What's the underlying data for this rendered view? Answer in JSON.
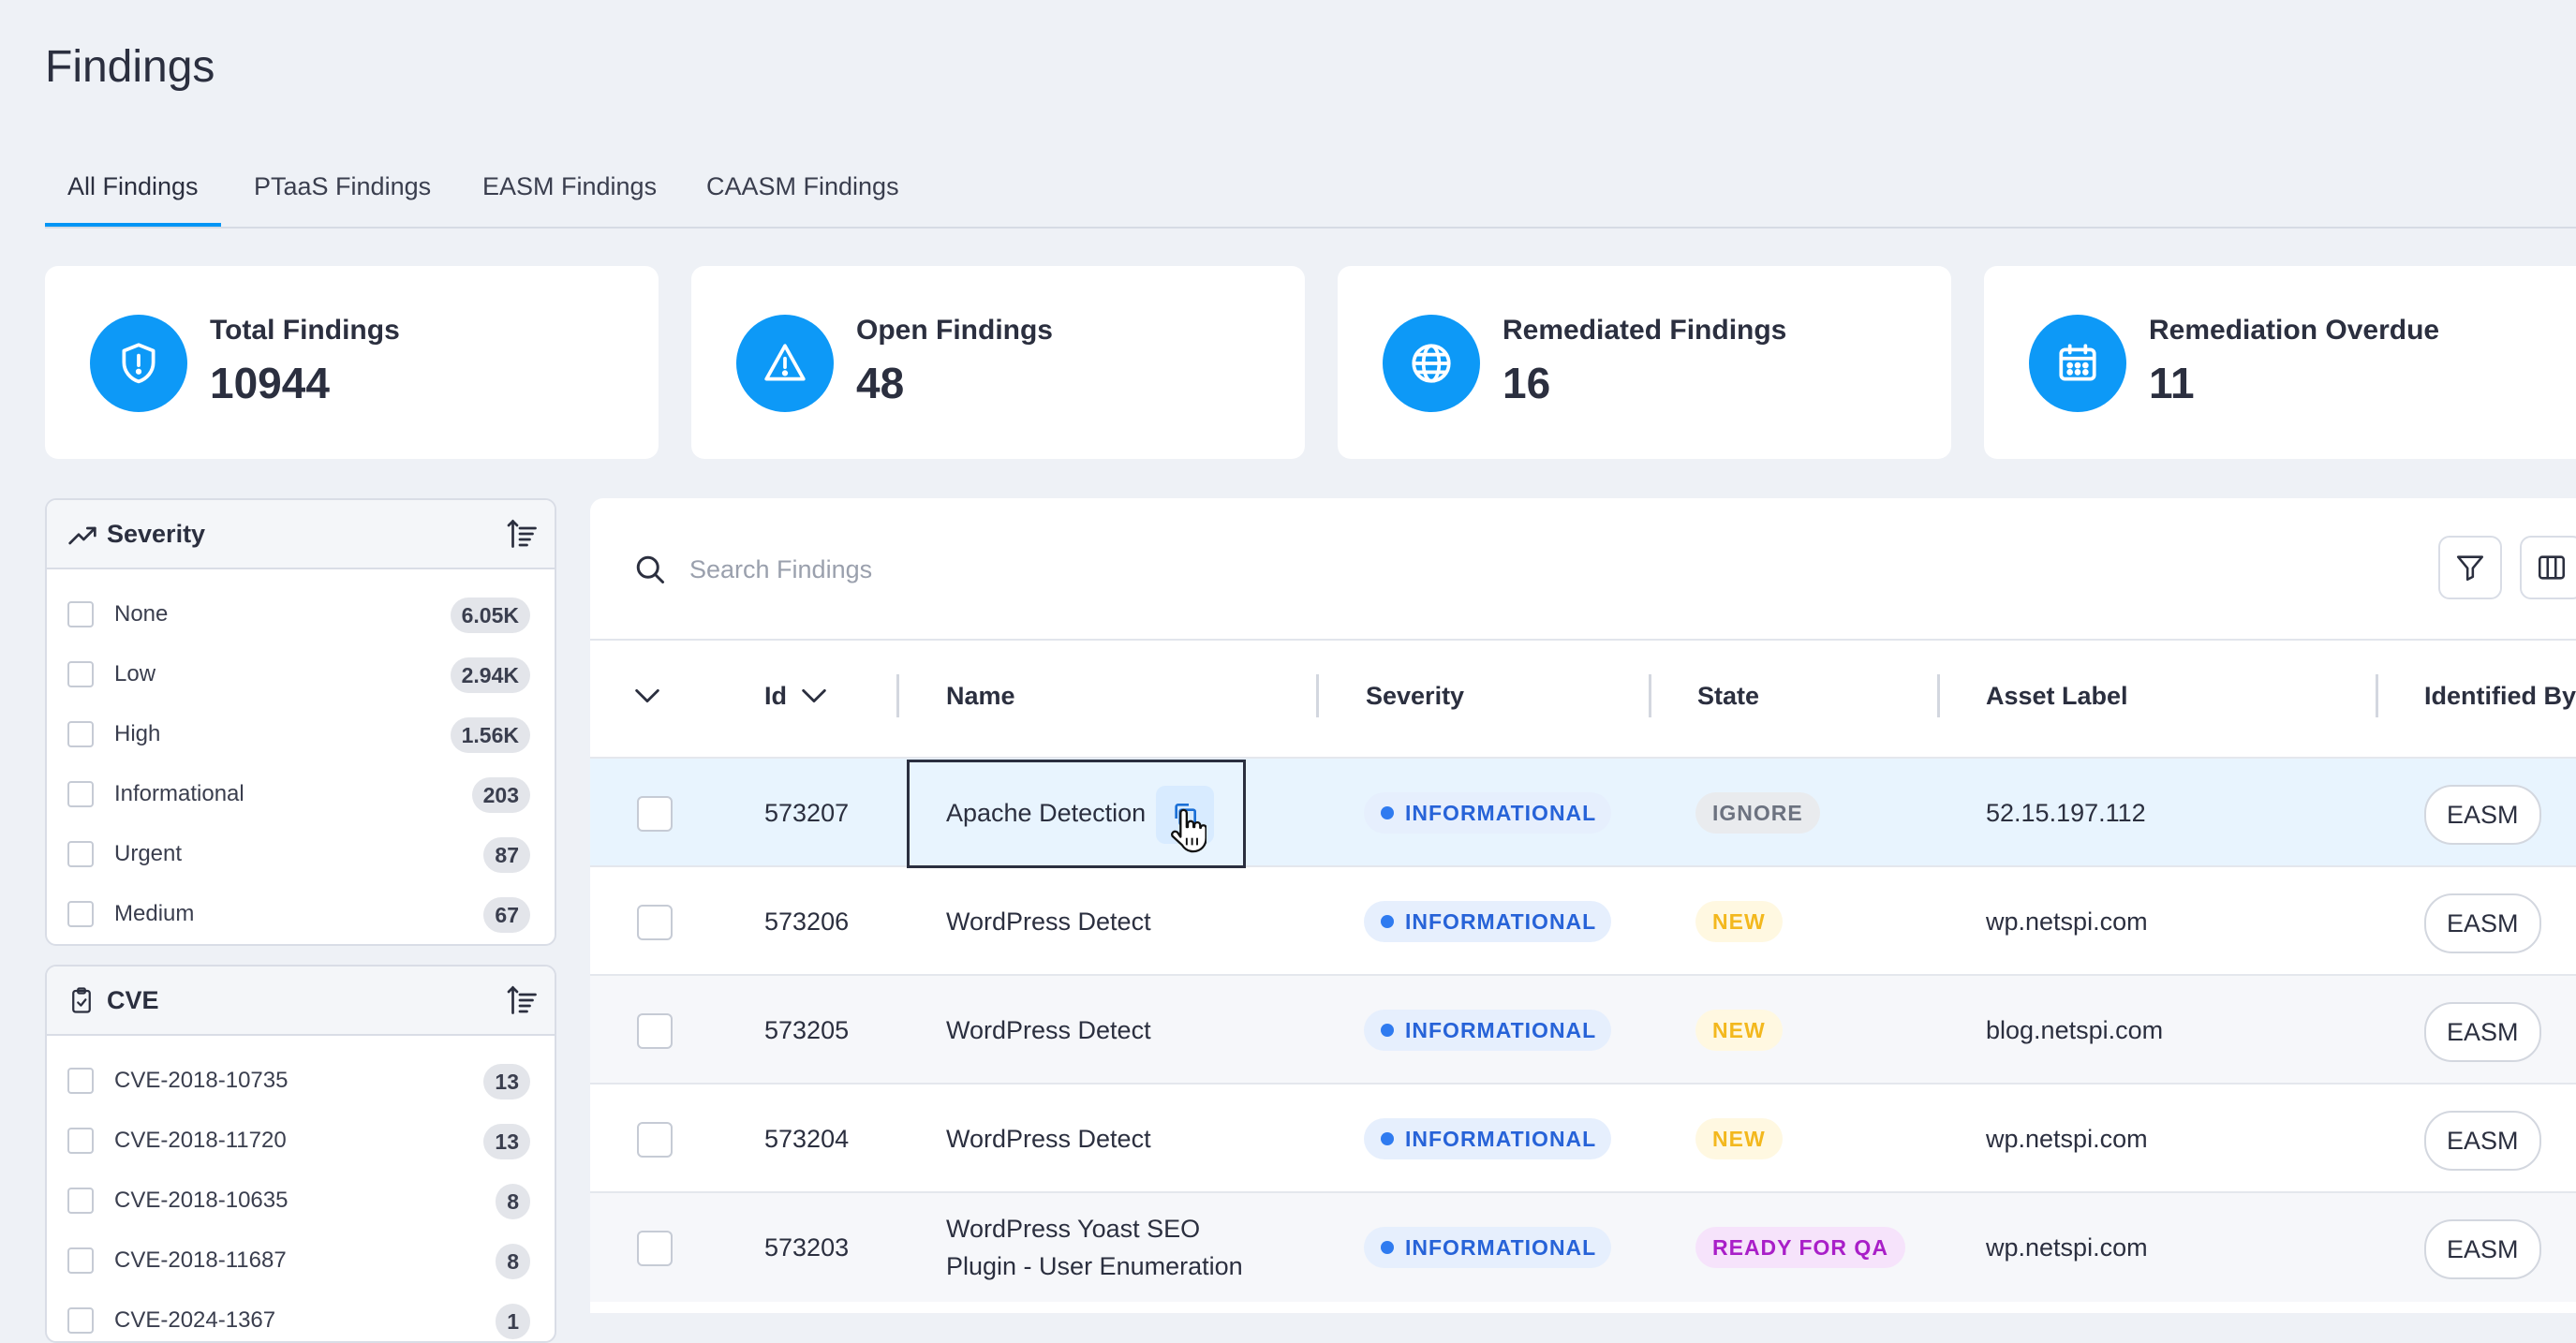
{
  "page": {
    "title": "Findings"
  },
  "tabs": [
    {
      "label": "All Findings",
      "active": true
    },
    {
      "label": "PTaaS Findings"
    },
    {
      "label": "EASM Findings"
    },
    {
      "label": "CAASM Findings"
    }
  ],
  "stats": [
    {
      "label": "Total Findings",
      "value": "10944",
      "icon": "shield-alert-icon"
    },
    {
      "label": "Open Findings",
      "value": "48",
      "icon": "warning-triangle-icon"
    },
    {
      "label": "Remediated Findings",
      "value": "16",
      "icon": "globe-icon"
    },
    {
      "label": "Remediation Overdue",
      "value": "11",
      "icon": "calendar-icon"
    }
  ],
  "facets": {
    "severity": {
      "title": "Severity",
      "items": [
        {
          "label": "None",
          "count": "6.05K"
        },
        {
          "label": "Low",
          "count": "2.94K"
        },
        {
          "label": "High",
          "count": "1.56K"
        },
        {
          "label": "Informational",
          "count": "203"
        },
        {
          "label": "Urgent",
          "count": "87"
        },
        {
          "label": "Medium",
          "count": "67"
        }
      ]
    },
    "cve": {
      "title": "CVE",
      "items": [
        {
          "label": "CVE-2018-10735",
          "count": "13"
        },
        {
          "label": "CVE-2018-11720",
          "count": "13"
        },
        {
          "label": "CVE-2018-10635",
          "count": "8"
        },
        {
          "label": "CVE-2018-11687",
          "count": "8"
        },
        {
          "label": "CVE-2024-1367",
          "count": "1"
        }
      ]
    }
  },
  "search": {
    "placeholder": "Search Findings"
  },
  "table": {
    "columns": {
      "id": "Id",
      "name": "Name",
      "severity": "Severity",
      "state": "State",
      "asset": "Asset Label",
      "identified_by": "Identified By"
    },
    "rows": [
      {
        "id": "573207",
        "name": "Apache Detection",
        "severity": "INFORMATIONAL",
        "state": "IGNORE",
        "asset": "52.15.197.112",
        "identified_by": "EASM"
      },
      {
        "id": "573206",
        "name": "WordPress Detect",
        "severity": "INFORMATIONAL",
        "state": "NEW",
        "asset": "wp.netspi.com",
        "identified_by": "EASM"
      },
      {
        "id": "573205",
        "name": "WordPress Detect",
        "severity": "INFORMATIONAL",
        "state": "NEW",
        "asset": "blog.netspi.com",
        "identified_by": "EASM"
      },
      {
        "id": "573204",
        "name": "WordPress Detect",
        "severity": "INFORMATIONAL",
        "state": "NEW",
        "asset": "wp.netspi.com",
        "identified_by": "EASM"
      },
      {
        "id": "573203",
        "name_line1": "WordPress Yoast SEO",
        "name_line2": "Plugin - User Enumeration",
        "severity": "INFORMATIONAL",
        "state": "READY FOR QA",
        "asset": "wp.netspi.com",
        "identified_by": "EASM"
      }
    ]
  },
  "colors": {
    "accent": "#0095f5",
    "state_ignore_bg": "#e9ebee",
    "state_ignore_fg": "#6c7280",
    "state_new_bg": "#fff8e1",
    "state_new_fg": "#f3b81e",
    "state_qa_bg": "#f6e3fb",
    "state_qa_fg": "#a91fc8",
    "row_highlight": "#e8f4fe",
    "row_alt": "#f6f7fa"
  }
}
